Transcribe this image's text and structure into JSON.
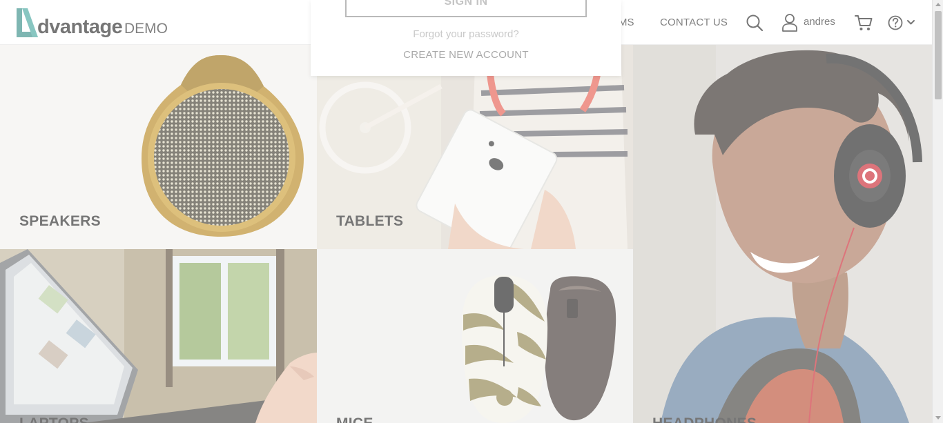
{
  "header": {
    "logo": {
      "word": "dvantage",
      "demo": "DEMO"
    },
    "nav": {
      "partial_item": "MS",
      "contact_us": "CONTACT US"
    },
    "user": {
      "name": "andres"
    },
    "icons": {
      "search": "search-icon",
      "user": "user-icon",
      "cart": "cart-icon",
      "help": "help-icon",
      "dropdown": "chevron-down-icon"
    }
  },
  "categories": [
    {
      "label": "SPEAKERS"
    },
    {
      "label": "TABLETS"
    },
    {
      "label": "HEADPHONES"
    },
    {
      "label": "LAPTOPS"
    },
    {
      "label": "MICE"
    }
  ],
  "login_popup": {
    "sign_in_button": "SIGN IN",
    "forgot_password": "Forgot your password?",
    "create_account": "CREATE NEW ACCOUNT"
  },
  "colors": {
    "brand_teal": "#2f8a84",
    "text_dark": "#222222",
    "muted_link": "#a9a9a9"
  }
}
